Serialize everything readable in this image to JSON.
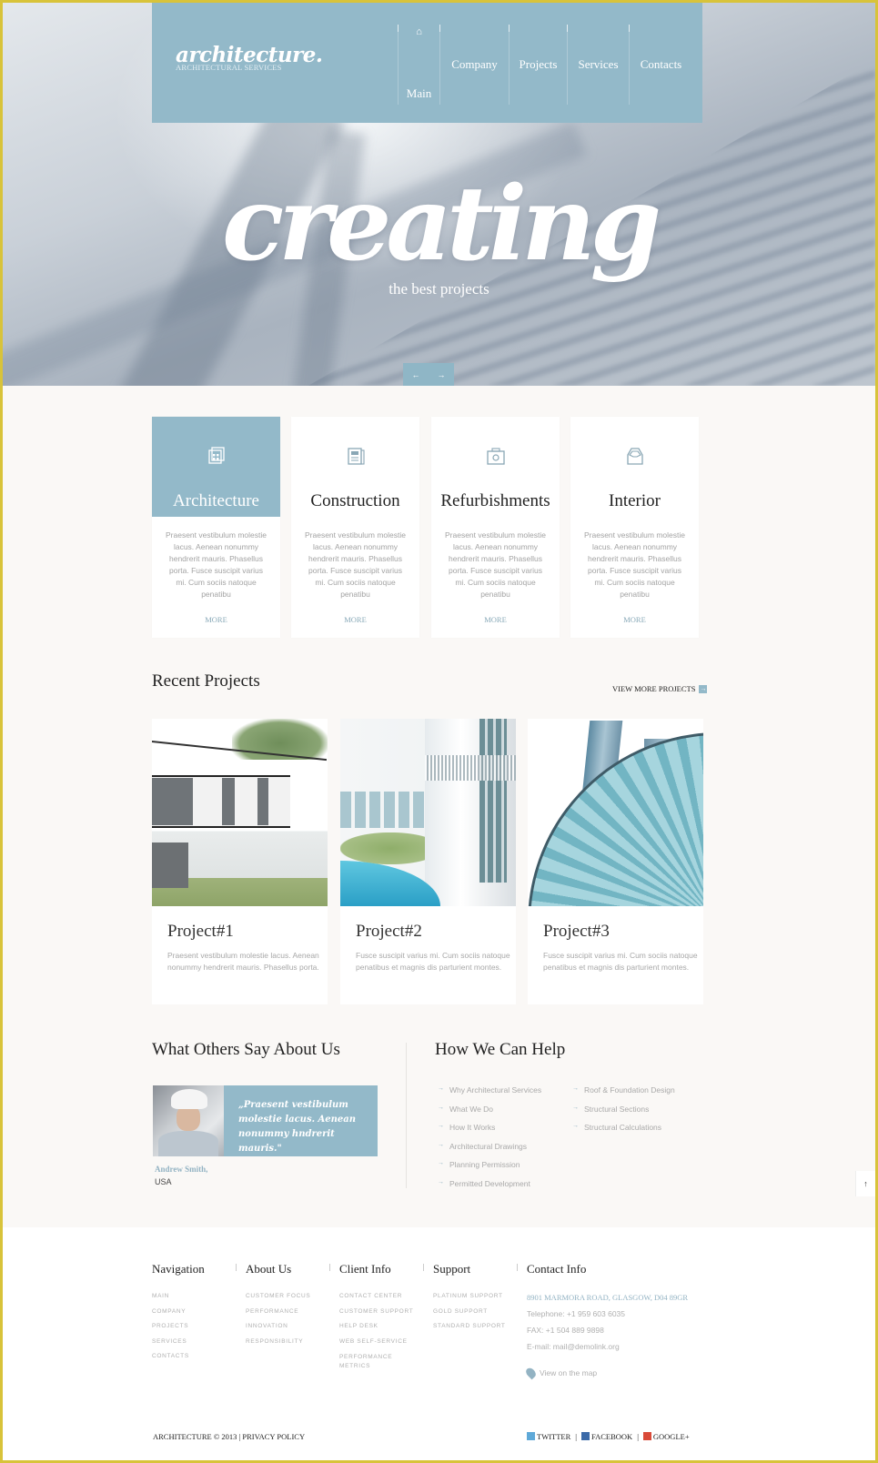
{
  "header": {
    "logo": "architecture.",
    "logo_sub": "ARCHITECTURAL SERVICES",
    "nav": [
      {
        "label": "Main",
        "icon": "home-icon"
      },
      {
        "label": "Company"
      },
      {
        "label": "Projects"
      },
      {
        "label": "Services"
      },
      {
        "label": "Contacts"
      }
    ]
  },
  "hero": {
    "title": "creating",
    "subtitle": "the best projects",
    "prev": "←",
    "next": "→"
  },
  "services": [
    {
      "title": "Architecture",
      "icon": "blueprint-icon",
      "text": "Praesent vestibulum molestie lacus. Aenean nonummy hendrerit mauris. Phasellus porta. Fusce suscipit varius mi. Cum sociis natoque penatibu",
      "more": "MORE",
      "active": true
    },
    {
      "title": "Construction",
      "icon": "document-icon",
      "text": "Praesent vestibulum molestie lacus. Aenean nonummy hendrerit mauris. Phasellus porta. Fusce suscipit varius mi. Cum sociis natoque penatibu",
      "more": "MORE"
    },
    {
      "title": "Refurbishments",
      "icon": "toolbox-icon",
      "text": "Praesent vestibulum molestie lacus. Aenean nonummy hendrerit mauris. Phasellus porta. Fusce suscipit varius mi. Cum sociis natoque penatibu",
      "more": "MORE"
    },
    {
      "title": "Interior",
      "icon": "interior-box-icon",
      "text": "Praesent vestibulum molestie lacus. Aenean nonummy hendrerit mauris. Phasellus porta. Fusce suscipit varius mi. Cum sociis natoque penatibu",
      "more": "MORE"
    }
  ],
  "recent": {
    "title": "Recent Projects",
    "view_more": "VIEW MORE PROJECTS",
    "projects": [
      {
        "title": "Project#1",
        "text": "Praesent vestibulum molestie lacus. Aenean nonummy hendrerit mauris. Phasellus porta."
      },
      {
        "title": "Project#2",
        "text": "Fusce suscipit varius mi. Cum sociis natoque penatibus et magnis dis parturient montes."
      },
      {
        "title": "Project#3",
        "text": "Fusce suscipit varius mi. Cum sociis natoque penatibus et magnis dis parturient montes."
      }
    ]
  },
  "testimonials": {
    "title": "What Others Say About Us",
    "quote": "„Praesent vestibulum molestie lacus. Aenean nonummy hndrerit mauris.\"",
    "author": "Andrew Smith,",
    "location": "USA"
  },
  "help": {
    "title": "How We Can Help",
    "col1": [
      "Why Architectural Services",
      "What We Do",
      "How It Works",
      "Architectural Drawings",
      "Planning Permission",
      "Permitted Development"
    ],
    "col2": [
      "Roof & Foundation Design",
      "Structural Sections",
      "Structural Calculations"
    ]
  },
  "footer": {
    "columns": [
      {
        "title": "Navigation",
        "items": [
          "MAIN",
          "COMPANY",
          "PROJECTS",
          "SERVICES",
          "CONTACTS"
        ]
      },
      {
        "title": "About Us",
        "items": [
          "CUSTOMER FOCUS",
          "PERFORMANCE",
          "INNOVATION",
          "RESPONSIBILITY"
        ]
      },
      {
        "title": "Client Info",
        "items": [
          "CONTACT CENTER",
          "CUSTOMER SUPPORT",
          "HELP DESK",
          "WEB SELF-SERVICE",
          "PERFORMANCE METRICS"
        ]
      },
      {
        "title": "Support",
        "items": [
          "PLATINUM SUPPORT",
          "GOLD SUPPORT",
          "STANDARD SUPPORT"
        ]
      }
    ],
    "contact": {
      "title": "Contact Info",
      "address": "8901 MARMORA ROAD, GLASGOW, D04 89GR",
      "telephone": "Telephone:  +1 959 603 6035",
      "fax": "FAX:  +1 504 889 9898",
      "email": "E-mail: mail@demolink.org",
      "map": "View on the map"
    },
    "copyright": "ARCHITECTURE © 2013",
    "privacy": "PRIVACY POLICY",
    "social": [
      {
        "label": "TWITTER",
        "color": "#5fa9d8"
      },
      {
        "label": "FACEBOOK",
        "color": "#3b6aa8"
      },
      {
        "label": "GOOGLE+",
        "color": "#d94a38"
      }
    ],
    "separator": "|",
    "to_top": "↑"
  },
  "colors": {
    "accent": "#93b9c9",
    "frame": "#d8c33a"
  }
}
